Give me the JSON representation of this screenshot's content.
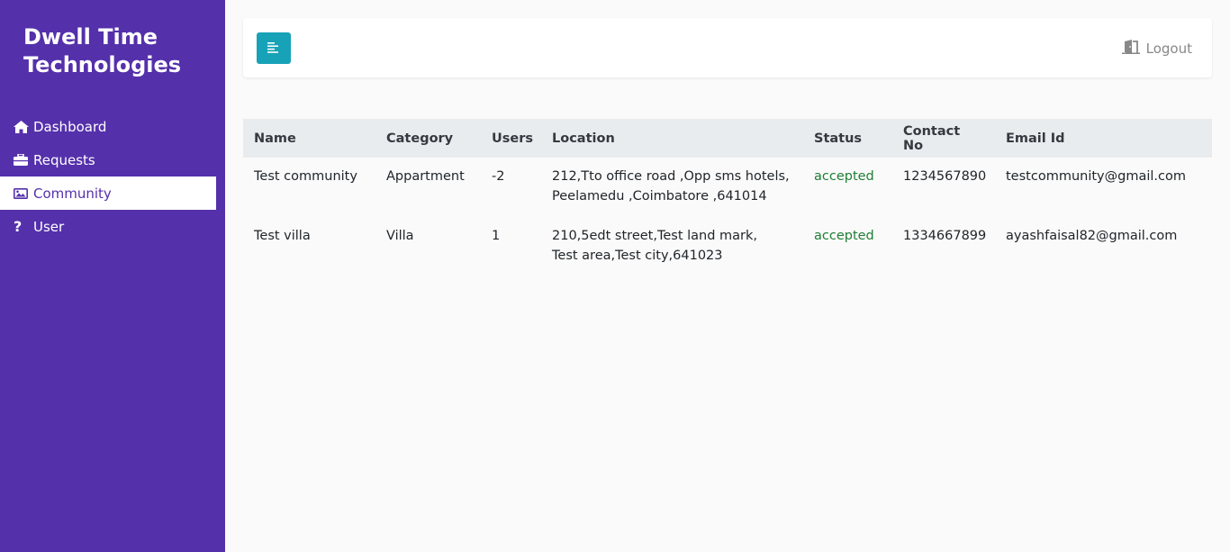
{
  "brand": {
    "title": "Dwell Time Technologies"
  },
  "sidebar": {
    "items": [
      {
        "label": "Dashboard",
        "icon": "home-icon",
        "active": false
      },
      {
        "label": "Requests",
        "icon": "briefcase-icon",
        "active": false
      },
      {
        "label": "Community",
        "icon": "image-icon",
        "active": true
      },
      {
        "label": "User",
        "icon": "question-icon",
        "active": false
      }
    ]
  },
  "topbar": {
    "toggle_icon": "align-left-icon",
    "logout_label": "Logout",
    "logout_icon": "door-icon"
  },
  "table": {
    "headers": [
      "Name",
      "Category",
      "Users",
      "Location",
      "Status",
      "Contact No",
      "Email Id"
    ],
    "rows": [
      {
        "name": "Test community",
        "category": "Appartment",
        "users": "-2",
        "location_line1": "212,Tto office road ,Opp sms hotels,",
        "location_line2": "Peelamedu ,Coimbatore ,641014",
        "status": "accepted",
        "contact": "1234567890",
        "email": "testcommunity@gmail.com"
      },
      {
        "name": "Test villa",
        "category": "Villa",
        "users": "1",
        "location_line1": "210,5edt street,Test land mark,",
        "location_line2": "Test area,Test city,641023",
        "status": "accepted",
        "contact": "1334667899",
        "email": "ayashfaisal82@gmail.com"
      }
    ]
  },
  "colors": {
    "sidebar_bg": "#5530ab",
    "toggle_bg": "#17a2b8",
    "status_accepted": "#1e7e34",
    "header_bg": "#e9ecef"
  }
}
